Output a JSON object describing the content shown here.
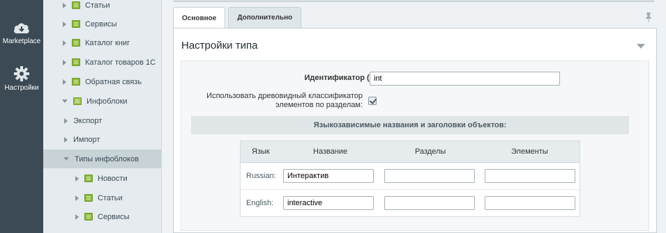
{
  "rail": {
    "marketplace_label": "Marketplace",
    "settings_label": "Настройки"
  },
  "tree": {
    "items": [
      {
        "label": "Статьи",
        "expanded": false
      },
      {
        "label": "Сервисы",
        "expanded": false
      },
      {
        "label": "Каталог книг",
        "expanded": false
      },
      {
        "label": "Каталог товаров 1С",
        "expanded": false
      },
      {
        "label": "Обратная связь",
        "expanded": false
      },
      {
        "label": "Инфоблоки",
        "expanded": true
      },
      {
        "label": "Экспорт",
        "expanded": false
      },
      {
        "label": "Импорт",
        "expanded": false
      },
      {
        "label": "Типы инфоблоков",
        "expanded": true,
        "active": true
      },
      {
        "label": "Новости",
        "expanded": false
      },
      {
        "label": "Статьи",
        "expanded": false
      },
      {
        "label": "Сервисы",
        "expanded": false
      }
    ]
  },
  "tabs": {
    "main_label": "Основное",
    "extra_label": "Дополнительно"
  },
  "panel": {
    "title": "Настройки типа"
  },
  "form": {
    "id_label": "Идентификатор (ID):",
    "id_value": "int",
    "tree_classifier_label_line1": "Использовать древовидный классификатор",
    "tree_classifier_label_line2": "элементов по разделам:",
    "tree_classifier_checked": true
  },
  "section": {
    "title": "Языкозависимые названия и заголовки объектов:"
  },
  "lang_table": {
    "headers": {
      "lang": "Язык",
      "name": "Название",
      "sections": "Разделы",
      "elements": "Элементы"
    },
    "rows": [
      {
        "lang": "Russian:",
        "name": "Интерактив",
        "sections": "",
        "elements": ""
      },
      {
        "lang": "English:",
        "name": "interactive",
        "sections": "",
        "elements": ""
      }
    ]
  },
  "colors": {
    "rail_bg": "#3b4a55",
    "tree_bg": "#e5ebee",
    "folder_green": "#8cb63c",
    "active_row": "#c8d3d8"
  }
}
